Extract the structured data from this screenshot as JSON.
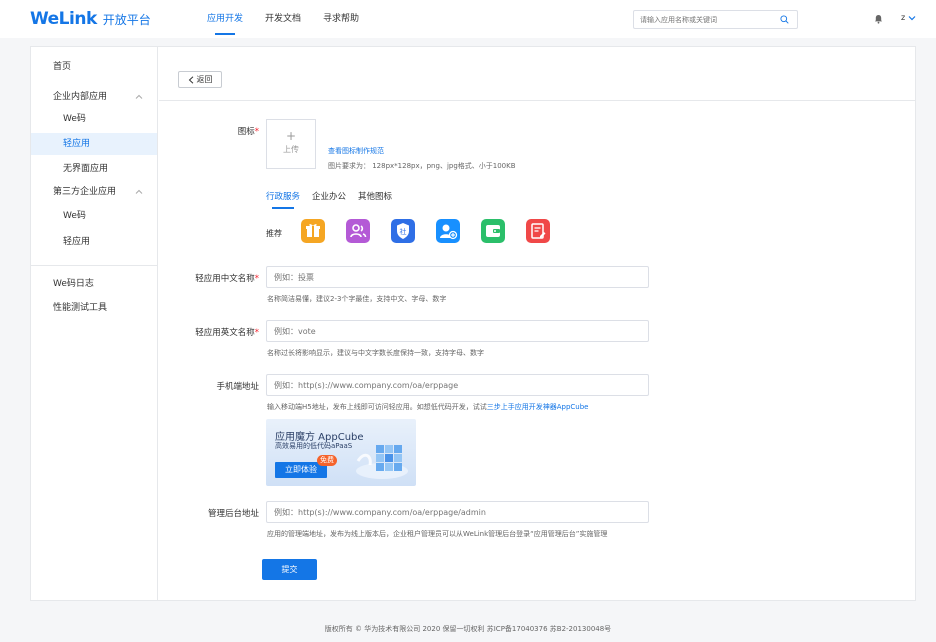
{
  "header": {
    "logo_main": "WeLink",
    "logo_sub": "开放平台",
    "nav": [
      "应用开发",
      "开发文档",
      "寻求帮助"
    ],
    "search_placeholder": "请输入应用名称或关键词",
    "user_initial": "z"
  },
  "sidebar": {
    "home": "首页",
    "internal_apps": "企业内部应用",
    "internal_we_code": "We码",
    "internal_light_app": "轻应用",
    "no_ui_app": "无界面应用",
    "third_party_apps": "第三方企业应用",
    "third_we_code": "We码",
    "third_light_app": "轻应用",
    "we_code_log": "We码日志",
    "perf_tool": "性能测试工具"
  },
  "topbar": {
    "back": "返回"
  },
  "form": {
    "icon_label": "图标",
    "upload_plus": "+",
    "upload_label": "上传",
    "spec_link": "查看图标制作规范",
    "spec_text": "图片要求为：  128px*128px，png、jpg格式、小于100KB",
    "tabs": [
      "行政服务",
      "企业办公",
      "其他图标"
    ],
    "recommend_label": "推荐",
    "cn_name_label": "轻应用中文名称",
    "cn_name_placeholder": "例如：投票",
    "cn_name_hint": "名称简洁易懂，建议2-3个字最佳，支持中文、字母、数字",
    "en_name_label": "轻应用英文名称",
    "en_name_placeholder": "例如：vote",
    "en_name_hint": "名称过长将影响显示，建议与中文字数长度保持一致，支持字母、数字",
    "mobile_url_label": "手机端地址",
    "mobile_url_placeholder": "例如：http(s)://www.company.com/oa/erppage",
    "mobile_url_hint": "输入移动端H5地址，发布上线即可访问轻应用。如想低代码开发，试试",
    "mobile_url_hint_link": "三步上手应用开发神器AppCube",
    "admin_url_label": "管理后台地址",
    "admin_url_placeholder": "例如：http(s)://www.company.com/oa/erppage/admin",
    "admin_url_hint": "应用的管理端地址，发布为线上版本后，企业租户管理员可以从WeLink管理后台登录“应用管理后台”实施管理",
    "submit": "提交",
    "required_mark": "*"
  },
  "banner": {
    "title": "应用魔方 AppCube",
    "subtitle": "高效易用的低代码aPaaS",
    "cta": "立即体验",
    "badge": "免费"
  },
  "rec_icons": [
    {
      "name": "gift-icon",
      "color": "#f5a623"
    },
    {
      "name": "contacts-icon",
      "color": "#b45ad6"
    },
    {
      "name": "social-security-icon",
      "color": "#2f6fe6"
    },
    {
      "name": "user-add-icon",
      "color": "#1890ff"
    },
    {
      "name": "wallet-icon",
      "color": "#2bbf6a"
    },
    {
      "name": "edit-doc-icon",
      "color": "#f04848"
    }
  ],
  "footer": {
    "text": "版权所有 © 华为技术有限公司 2020 保留一切权利 苏ICP备17040376 苏B2-20130048号"
  }
}
